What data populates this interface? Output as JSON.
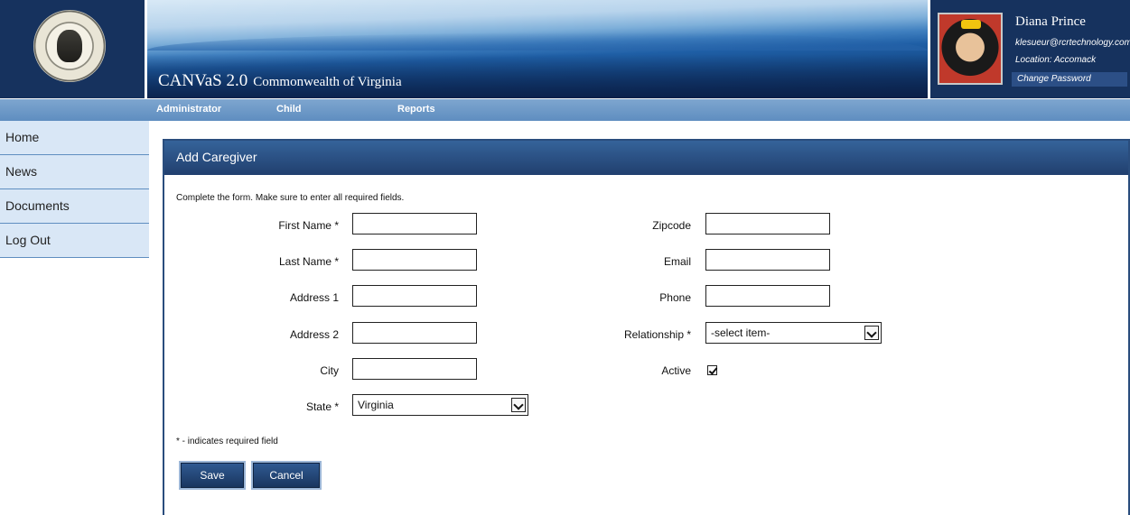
{
  "header": {
    "app_title": "CANVaS 2.0",
    "app_subtitle": "Commonwealth of Virginia",
    "user": {
      "name": "Diana Prince",
      "email": "klesueur@rcrtechnology.com",
      "location": "Location: Accomack",
      "change_password": "Change Password"
    }
  },
  "topnav": [
    "Administrator",
    "Child",
    "Reports"
  ],
  "sidebar": [
    "Home",
    "News",
    "Documents",
    "Log Out"
  ],
  "form": {
    "title": "Add Caregiver",
    "instructions": "Complete the form. Make sure to enter all required fields.",
    "first_name_label": "First Name *",
    "first_name_value": "",
    "last_name_label": "Last Name *",
    "last_name_value": "",
    "address1_label": "Address 1",
    "address1_value": "",
    "address2_label": "Address 2",
    "address2_value": "",
    "city_label": "City",
    "city_value": "",
    "state_label": "State *",
    "state_value": "Virginia",
    "zipcode_label": "Zipcode",
    "zipcode_value": "",
    "email_label": "Email",
    "email_value": "",
    "phone_label": "Phone",
    "phone_value": "",
    "relationship_label": "Relationship *",
    "relationship_value": "-select item-",
    "active_label": "Active",
    "active_checked": true,
    "required_note": "* - indicates required field",
    "save_label": "Save",
    "cancel_label": "Cancel"
  }
}
